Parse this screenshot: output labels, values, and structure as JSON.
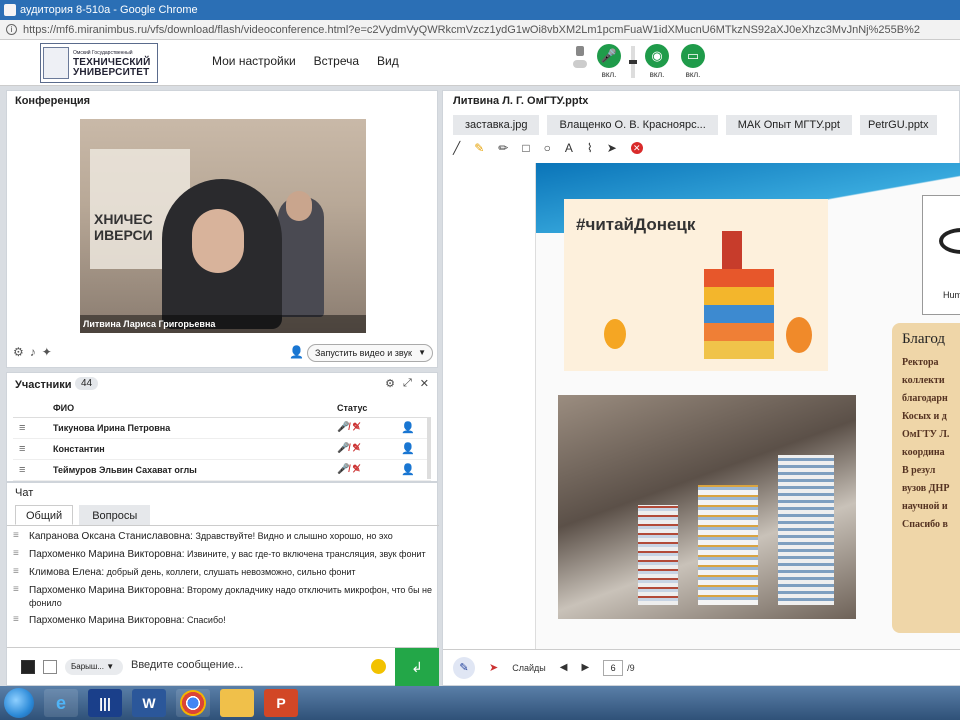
{
  "window": {
    "title": "аудитория 8-510а - Google Chrome"
  },
  "browser": {
    "url": "https://mf6.miranimbus.ru/vfs/download/flash/videoconference.html?e=c2VydmVyQWRkcmVzcz1ydG1wOi8vbXM2Lm1pcmFuaW1idXMucnU6MTkzNS92aXJ0eXhzc3MvJnNj%255B%2"
  },
  "header": {
    "logo": {
      "line1": "Омский Государственный",
      "line2": "ТЕХНИЧЕСКИЙ",
      "line3": "УНИВЕРСИТЕТ"
    },
    "menu": [
      "Мои настройки",
      "Встреча",
      "Вид"
    ],
    "controls": [
      {
        "label": "вкл.",
        "icon": "microphone-icon"
      },
      {
        "label": "вкл.",
        "icon": "webcam-icon"
      },
      {
        "label": "вкл.",
        "icon": "screen-share-icon"
      }
    ]
  },
  "conference": {
    "title": "Конференция",
    "video_caption": "Литвина Лариса   Григорьевна",
    "start_video_label": "Запустить видео и звук"
  },
  "participants": {
    "title": "Участники",
    "count": "44",
    "col_name": "ФИО",
    "col_status": "Статус",
    "rows": [
      {
        "name": "Тикунова Ирина   Петровна"
      },
      {
        "name": "Константин"
      },
      {
        "name": "Теймуров Эльвин Сахават оглы"
      }
    ]
  },
  "chat": {
    "title": "Чат",
    "tabs": [
      "Общий",
      "Вопросы"
    ],
    "messages": [
      {
        "author": "Капранова Оксана   Станиславовна:",
        "text": "Здравствуйте! Видно и слышно хорошо, но эхо"
      },
      {
        "author": "Пархоменко Марина   Викторовна:",
        "text": "Извините, у вас где-то включена трансляция, звук фонит"
      },
      {
        "author": "Климова Елена:",
        "text": "добрый день, коллеги, слушать невозможно, сильно фонит"
      },
      {
        "author": "Пархоменко Марина   Викторовна:",
        "text": "Второму докладчику надо отключить микрофон, что бы не фонило"
      },
      {
        "author": "Пархоменко Марина   Викторовна:",
        "text": "Спасибо!"
      }
    ],
    "font_select": "Барыш...",
    "input_placeholder": "Введите сообщение..."
  },
  "presentation": {
    "title": "Литвина Л. Г. ОмГТУ.pptx",
    "file_tabs": [
      "заставка.jpg",
      "Влащенко О. В. Красноярс...",
      "МАК Опыт МГТУ.ppt",
      "PetrGU.pptx"
    ],
    "slide": {
      "poster_tag": "#читайДонецк",
      "logo_text": "Hum",
      "parchment_title": "Благод",
      "parchment_lines": [
        "Ректора",
        "коллекти",
        "благодарн",
        "Косых и д",
        "ОмГТУ Л.",
        "координа",
        "В резул",
        "вузов ДНР",
        "научной и",
        "Спасибо в"
      ]
    },
    "nav": {
      "slides_label": "Слайды",
      "current_page": "6",
      "total": "/9"
    }
  },
  "taskbar": {
    "apps": [
      "start",
      "internet-explorer",
      "miranimbus",
      "word",
      "chrome",
      "explorer",
      "powerpoint"
    ]
  }
}
